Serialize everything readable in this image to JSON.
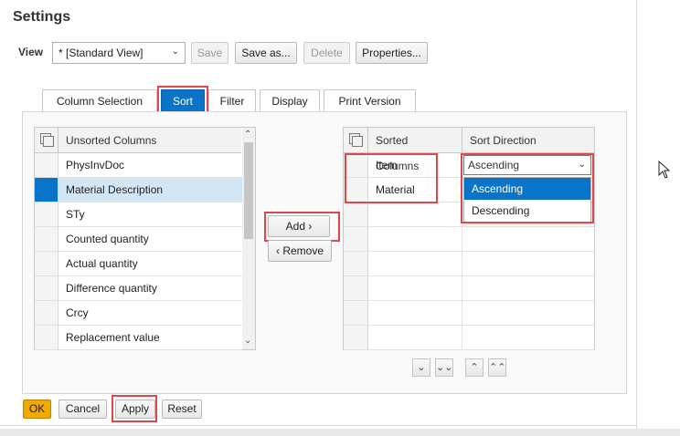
{
  "title": "Settings",
  "view": {
    "label": "View",
    "selected": "* [Standard View]",
    "buttons": {
      "save": "Save",
      "save_as": "Save as...",
      "delete": "Delete",
      "properties": "Properties..."
    }
  },
  "tabs": [
    "Column Selection",
    "Sort",
    "Filter",
    "Display",
    "Print Version"
  ],
  "active_tab": "Sort",
  "unsorted": {
    "header": "Unsorted Columns",
    "items": [
      "PhysInvDoc",
      "Material Description",
      "STy",
      "Counted quantity",
      "Actual quantity",
      "Difference quantity",
      "Crcy",
      "Replacement value"
    ],
    "selected_index": 1
  },
  "move": {
    "add": "Add",
    "remove": "Remove"
  },
  "sorted": {
    "headers": {
      "column": "Sorted Columns",
      "direction": "Sort Direction"
    },
    "rows": [
      {
        "column": "Item",
        "direction": "Ascending"
      },
      {
        "column": "Material",
        "direction": ""
      }
    ]
  },
  "direction_dropdown": {
    "value": "Ascending",
    "options": [
      "Ascending",
      "Descending"
    ],
    "highlighted": "Ascending"
  },
  "footer": {
    "ok": "OK",
    "cancel": "Cancel",
    "apply": "Apply",
    "reset": "Reset"
  },
  "colors": {
    "accent": "#0a74c9",
    "highlight_box": "#e0474c",
    "ok_button": "#f2a900",
    "selected_row": "#d2e6f5"
  }
}
